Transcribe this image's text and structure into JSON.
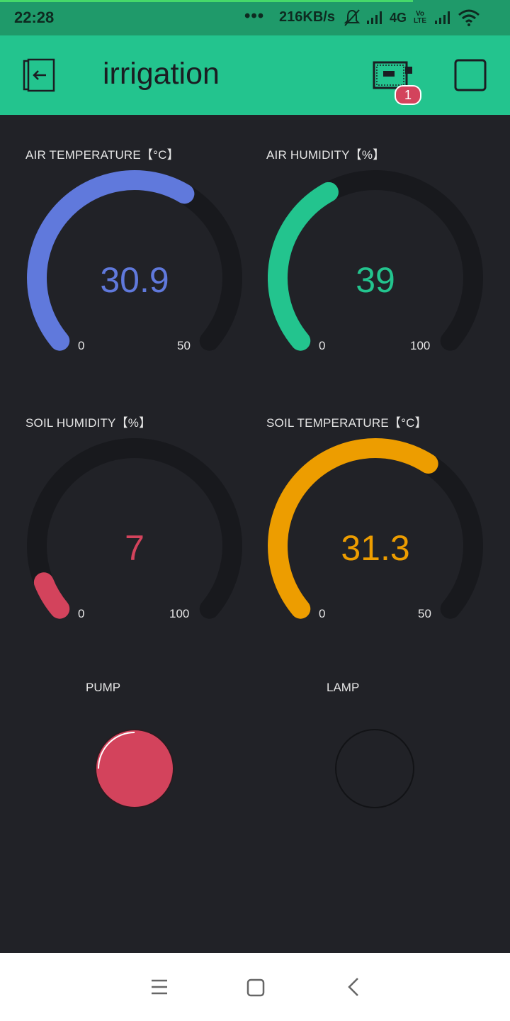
{
  "status_bar": {
    "time": "22:28",
    "dots": "•••",
    "speed": "216KB/s",
    "network": "4G",
    "volte": "Vo LTE"
  },
  "header": {
    "title": "irrigation",
    "device_badge": "1",
    "icons": [
      "exit-icon",
      "device-icon",
      "stop-icon"
    ]
  },
  "gauges": [
    {
      "label": "AIR TEMPERATURE【°C】",
      "value": "30.9",
      "min": "0",
      "max": "50",
      "fraction": 0.618,
      "color": "#6079dc"
    },
    {
      "label": "AIR HUMIDITY【%】",
      "value": "39",
      "min": "0",
      "max": "100",
      "fraction": 0.39,
      "color": "#23c48e"
    },
    {
      "label": "SOIL HUMIDITY【%】",
      "value": "7",
      "min": "0",
      "max": "100",
      "fraction": 0.07,
      "color": "#d3435c"
    },
    {
      "label": "SOIL TEMPERATURE【°C】",
      "value": "31.3",
      "min": "0",
      "max": "50",
      "fraction": 0.626,
      "color": "#ed9d00"
    }
  ],
  "buttons": [
    {
      "label": "PUMP",
      "state": "on",
      "color": "#d3435c"
    },
    {
      "label": "LAMP",
      "state": "off",
      "color": "#212227"
    }
  ],
  "colors": {
    "header": "#23c48e",
    "background": "#212227",
    "gauge_track": "#18191d"
  },
  "nav_bar": [
    "menu-icon",
    "home-icon",
    "back-icon"
  ]
}
